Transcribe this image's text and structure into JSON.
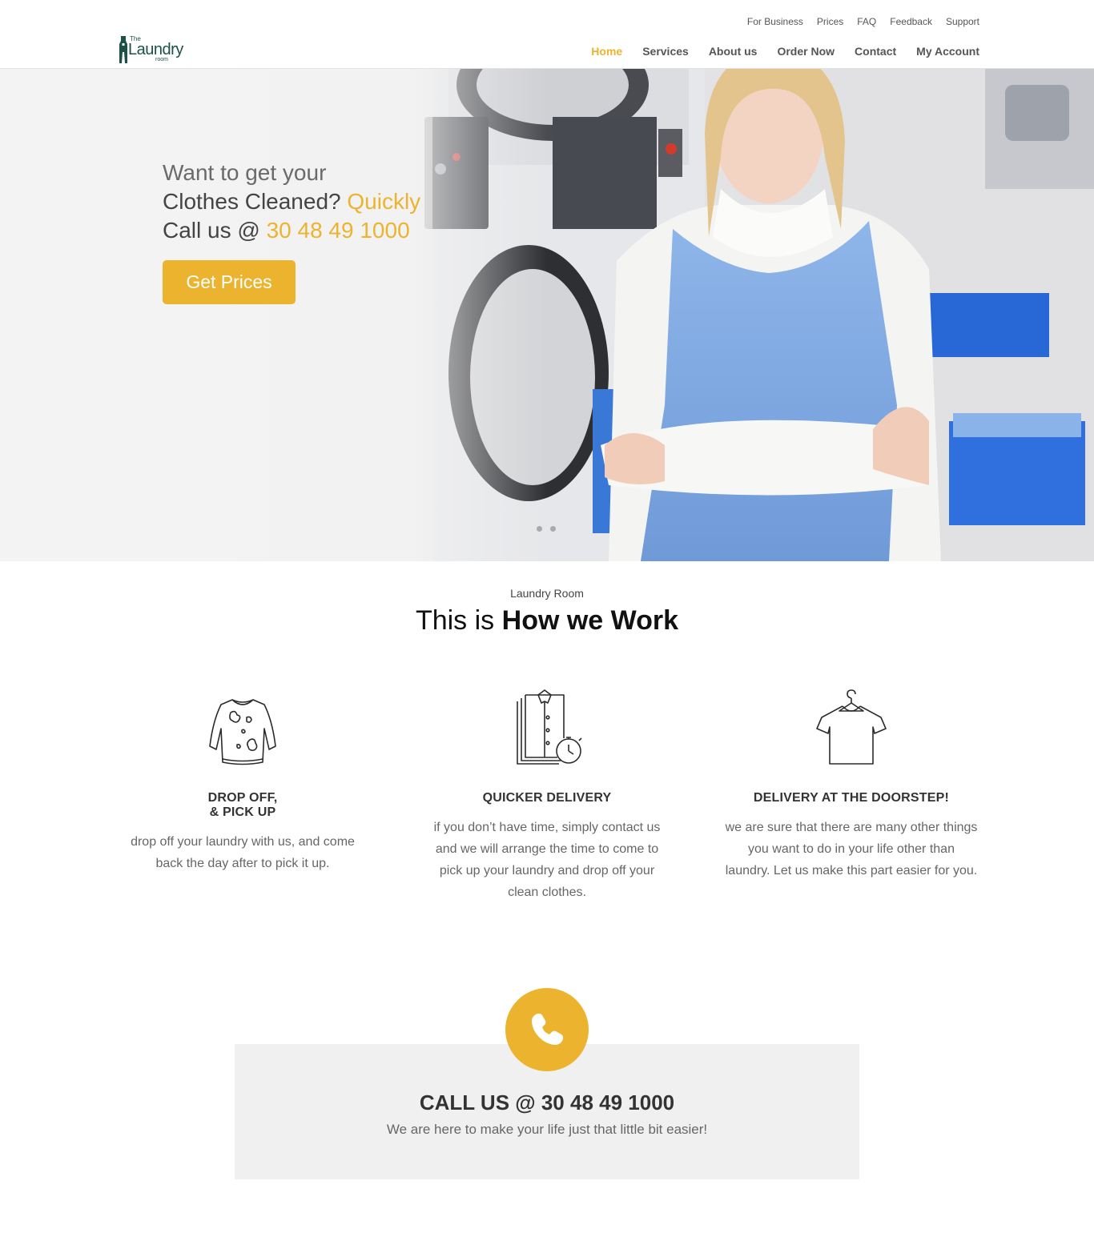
{
  "brand": {
    "logo_the": "The",
    "logo_main": "Laundry",
    "logo_room": "room"
  },
  "top_nav": [
    "For Business",
    "Prices",
    "FAQ",
    "Feedback",
    "Support"
  ],
  "main_nav": {
    "items": [
      "Home",
      "Services",
      "About us",
      "Order Now",
      "Contact",
      "My Account"
    ],
    "active": "Home"
  },
  "hero": {
    "line1": "Want to get your",
    "line2_text": "Clothes Cleaned? ",
    "line2_accent": "Quickly",
    "line3_text": "Call us @ ",
    "line3_accent": "30 48 49 1000",
    "button": "Get Prices",
    "slides": 2
  },
  "how": {
    "kicker": "Laundry Room",
    "title_thin": "This is ",
    "title_bold": "How we Work",
    "features": [
      {
        "icon": "stained-sweater-icon",
        "title_line1": "DROP OFF,",
        "title_line2": "& PICK UP",
        "body": "drop off your laundry with us, and come back the day after to pick it up."
      },
      {
        "icon": "shirts-stopwatch-icon",
        "title_line1": "QUICKER DELIVERY",
        "title_line2": "",
        "body": "if you don’t have time, simply contact us and we will arrange the time to come to pick up your laundry and drop off your clean clothes."
      },
      {
        "icon": "tshirt-hanger-icon",
        "title_line1": "DELIVERY AT THE DOORSTEP!",
        "title_line2": "",
        "body": "we are sure that there are many other things you want to do in your life other than laundry. Let us make this part easier for you."
      }
    ]
  },
  "call": {
    "icon": "phone-icon",
    "title": "CALL US @ 30 48 49 1000",
    "subtitle": "We are here to make your life just that little bit easier!"
  },
  "colors": {
    "accent": "#ecb42e",
    "logo": "#1c5148",
    "callbox_bg": "#f0f0f1"
  }
}
